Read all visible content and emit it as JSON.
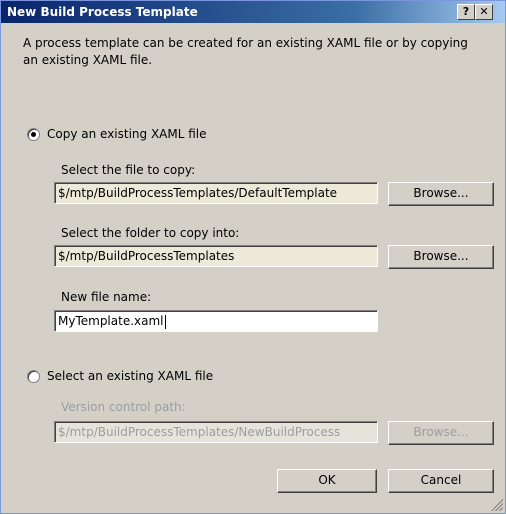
{
  "window": {
    "title": "New Build Process Template",
    "help_label": "?",
    "close_label": "✕"
  },
  "intro_text": "A process template can be created for an existing XAML file or by copying an existing XAML file.",
  "copy_option": {
    "label": "Copy an existing XAML file",
    "selected": true,
    "source_label": "Select the file to copy:",
    "source_value": "$/mtp/BuildProcessTemplates/DefaultTemplate",
    "source_browse": "Browse...",
    "folder_label": "Select the folder to copy into:",
    "folder_value": "$/mtp/BuildProcessTemplates",
    "folder_browse": "Browse...",
    "filename_label": "New file name:",
    "filename_value": "MyTemplate.xaml"
  },
  "select_option": {
    "label": "Select an existing XAML file",
    "selected": false,
    "path_label": "Version control path:",
    "path_value": "$/mtp/BuildProcessTemplates/NewBuildProcess",
    "path_browse": "Browse..."
  },
  "buttons": {
    "ok": "OK",
    "cancel": "Cancel"
  }
}
